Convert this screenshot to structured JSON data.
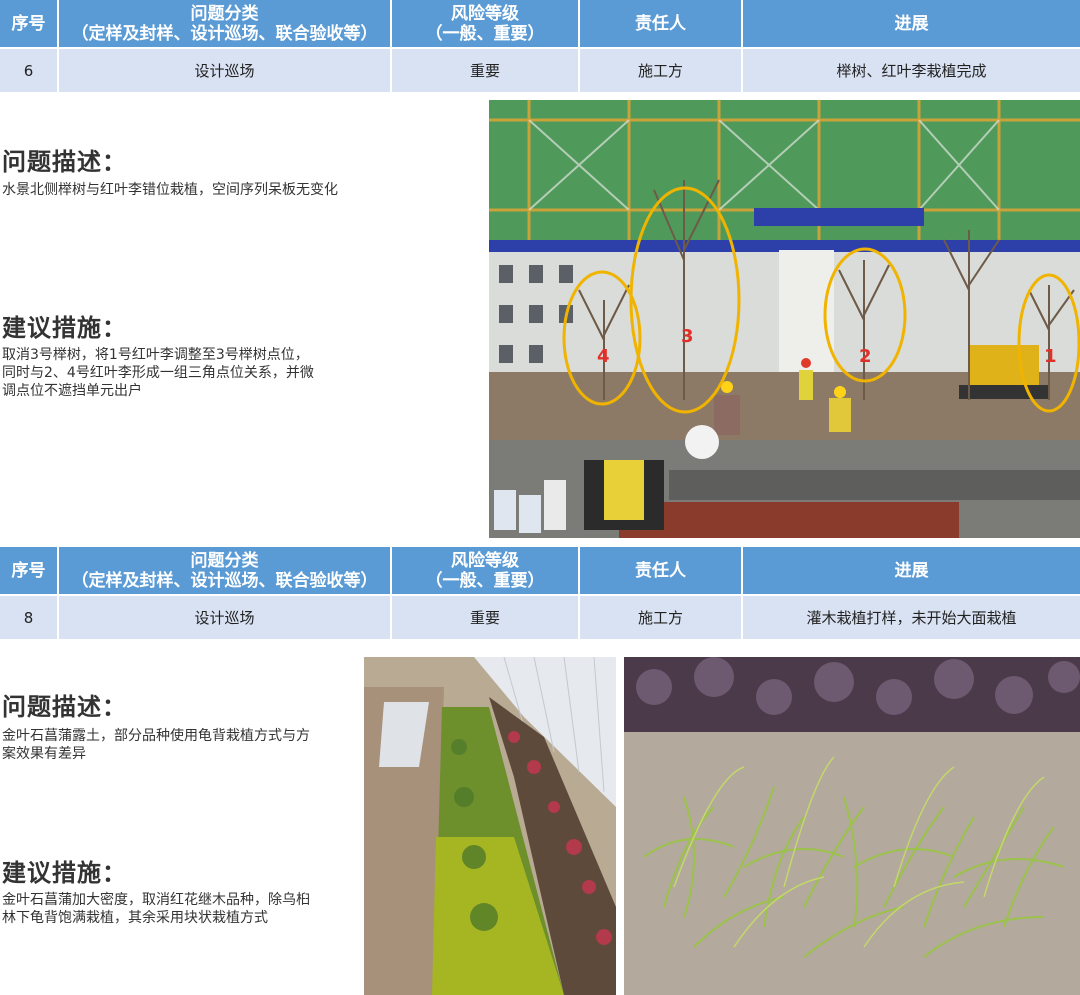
{
  "headers": {
    "no": "序号",
    "category_line1": "问题分类",
    "category_line2": "（定样及封样、设计巡场、联合验收等）",
    "risk_line1": "风险等级",
    "risk_line2": "（一般、重要）",
    "owner": "责任人",
    "progress": "进展"
  },
  "items": [
    {
      "no": "6",
      "category": "设计巡场",
      "risk": "重要",
      "owner": "施工方",
      "progress": "榉树、红叶李栽植完成",
      "problem_title": "问题描述：",
      "problem_text": "水景北侧榉树与红叶李错位栽植，空间序列呆板无变化",
      "suggest_title": "建议措施：",
      "suggest_lines": [
        "取消3号榉树，将1号红叶李调整至3号榉树点位，",
        "同时与2、4号红叶李形成一组三角点位关系，并微",
        "调点位不遮挡单元出户"
      ],
      "photo_markers": [
        "4",
        "3",
        "2",
        "1"
      ]
    },
    {
      "no": "8",
      "category": "设计巡场",
      "risk": "重要",
      "owner": "施工方",
      "progress": "灌木栽植打样，未开始大面栽植",
      "problem_title": "问题描述：",
      "problem_lines": [
        "金叶石菖蒲露土，部分品种使用龟背栽植方式与方",
        "案效果有差异"
      ],
      "suggest_title": "建议措施：",
      "suggest_lines": [
        "金叶石菖蒲加大密度，取消红花继木品种，除乌桕",
        "林下龟背饱满栽植，其余采用块状栽植方式"
      ]
    }
  ],
  "colors": {
    "header_bg": "#5b9bd5",
    "row_bg": "#d9e2f3",
    "marker": "#f0b400"
  }
}
